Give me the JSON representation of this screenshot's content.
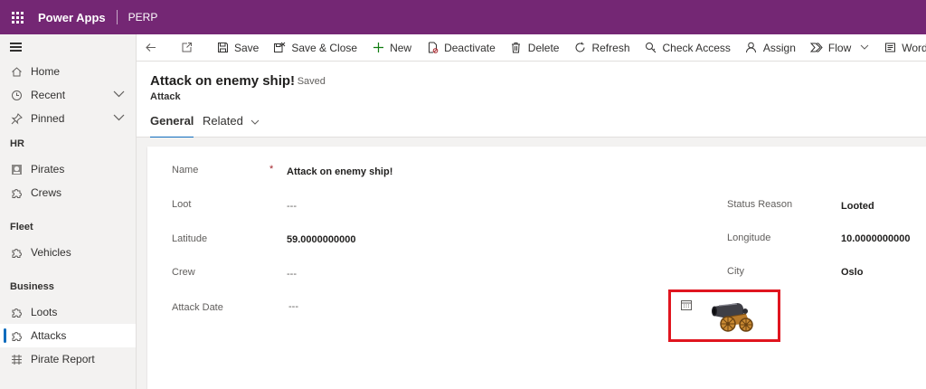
{
  "app": {
    "title": "Power Apps",
    "environment": "PERP"
  },
  "sidebar": {
    "items": [
      {
        "label": "Home",
        "icon": "home-icon"
      },
      {
        "label": "Recent",
        "icon": "clock-icon"
      },
      {
        "label": "Pinned",
        "icon": "pin-icon"
      }
    ],
    "groups": [
      {
        "title": "HR",
        "items": [
          {
            "label": "Pirates",
            "icon": "pirate-icon"
          },
          {
            "label": "Crews",
            "icon": "puzzle-icon"
          }
        ]
      },
      {
        "title": "Fleet",
        "items": [
          {
            "label": "Vehicles",
            "icon": "puzzle-icon"
          }
        ]
      },
      {
        "title": "Business",
        "items": [
          {
            "label": "Loots",
            "icon": "puzzle-icon"
          },
          {
            "label": "Attacks",
            "icon": "puzzle-icon",
            "active": true
          },
          {
            "label": "Pirate Report",
            "icon": "report-icon"
          }
        ]
      }
    ]
  },
  "commands": {
    "save": "Save",
    "save_close": "Save & Close",
    "new": "New",
    "deactivate": "Deactivate",
    "delete": "Delete",
    "refresh": "Refresh",
    "check_access": "Check Access",
    "assign": "Assign",
    "flow": "Flow",
    "word_templates": "Word Templates"
  },
  "record": {
    "title": "Attack on enemy ship!",
    "status": "- Saved",
    "entity": "Attack",
    "tabs": {
      "general": "General",
      "related": "Related"
    }
  },
  "form": {
    "name": {
      "label": "Name",
      "required": "*",
      "value": "Attack on enemy ship!"
    },
    "loot": {
      "label": "Loot",
      "value": "---"
    },
    "latitude": {
      "label": "Latitude",
      "value": "59.0000000000"
    },
    "crew": {
      "label": "Crew",
      "value": "---"
    },
    "attack_date": {
      "label": "Attack Date",
      "value": "---"
    },
    "status_reason": {
      "label": "Status Reason",
      "value": "Looted"
    },
    "longitude": {
      "label": "Longitude",
      "value": "10.0000000000"
    },
    "city": {
      "label": "City",
      "value": "Oslo"
    }
  },
  "colors": {
    "brand": "#742774",
    "accent": "#0f6cbd",
    "highlight": "#e0151f"
  }
}
